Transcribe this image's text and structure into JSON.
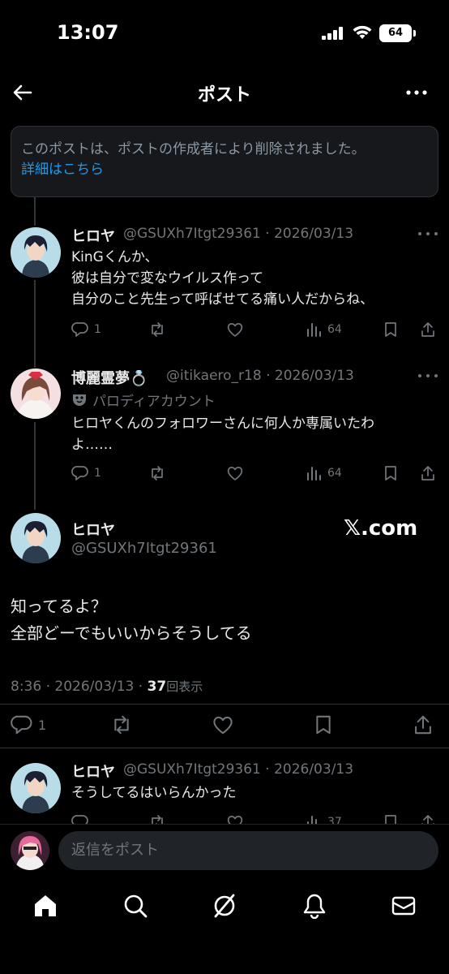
{
  "status": {
    "time": "13:07",
    "battery": "64"
  },
  "header": {
    "title": "ポスト"
  },
  "deleted": {
    "text": "このポストは、ポストの作成者により削除されました。",
    "link": "詳細はこちら"
  },
  "reply1": {
    "name": "ヒロヤ",
    "handle": "@GSUXh7Itgt29361 · 2026/03/13",
    "lines": [
      "KinGくんか、",
      "彼は自分で変なウイルス作って",
      "自分のこと先生って呼ばせてる痛い人だからね、"
    ],
    "replies": "1",
    "views": "64"
  },
  "reply2": {
    "name": "博麗霊夢",
    "name_emoji": "💍",
    "handle": "@itikaero_r18 · 2026/03/13",
    "parody": "パロディアカウント",
    "lines": [
      "ヒロヤくんのフォロワーさんに何人か専属いたわ",
      "よ……"
    ],
    "replies": "1",
    "views": "64"
  },
  "main": {
    "name": "ヒロヤ",
    "handle": "@GSUXh7Itgt29361",
    "watermark": "𝕏.com",
    "lines": [
      "知ってるよ？",
      "全部どーでもいいからそうしてる"
    ],
    "meta_prefix": "8:36 · 2026/03/13 · ",
    "view_count": "37",
    "view_label": "回表示",
    "replies": "1"
  },
  "reply3": {
    "name": "ヒロヤ",
    "handle": "@GSUXh7Itgt29361 · 2026/03/13",
    "lines": [
      "そうしてるはいらんかった"
    ],
    "views": "37"
  },
  "reply_bar": {
    "placeholder": "返信をポスト"
  },
  "colors": {
    "accent": "#1d9bf0",
    "muted": "#71767b",
    "background": "#000000"
  }
}
